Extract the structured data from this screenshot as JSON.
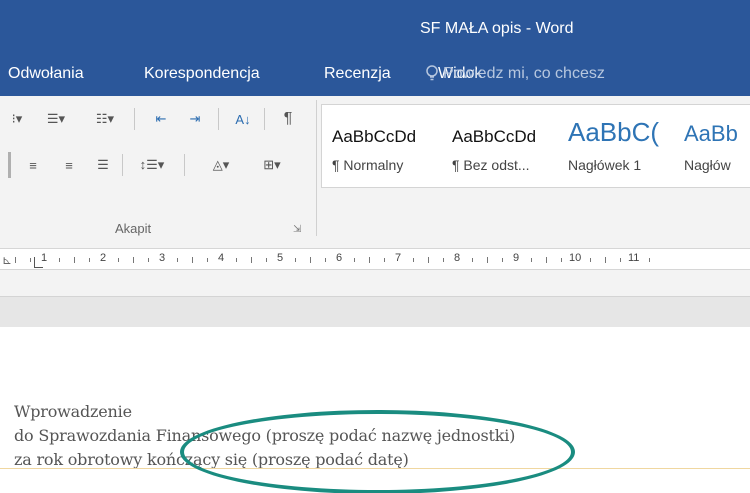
{
  "window": {
    "title": "SF MAŁA opis - Word"
  },
  "menu": {
    "tabs": [
      "Odwołania",
      "Korespondencja",
      "Recenzja",
      "Widok"
    ],
    "tell_me": "Powiedz mi, co chcesz"
  },
  "ribbon": {
    "paragraph_group_label": "Akapit",
    "styles": [
      {
        "sample": "AaBbCcDd",
        "name": "¶ Normalny"
      },
      {
        "sample": "AaBbCcDd",
        "name": "¶ Bez odst..."
      },
      {
        "sample": "AaBbC(",
        "name": "Nagłówek 1"
      },
      {
        "sample": "AaBb",
        "name": "Nagłów"
      }
    ]
  },
  "ruler": {
    "numbers": [
      "1",
      "2",
      "3",
      "4",
      "5",
      "6",
      "7",
      "8",
      "9",
      "10",
      "11"
    ]
  },
  "document": {
    "lines": [
      "Wprowadzenie",
      "do Sprawozdania Finansowego (proszę podać nazwę jednostki)",
      "za rok obrotowy kończący się (proszę podać datę)"
    ]
  },
  "colors": {
    "title_bar": "#2b579a",
    "annotation_ring": "#1a8c80"
  }
}
